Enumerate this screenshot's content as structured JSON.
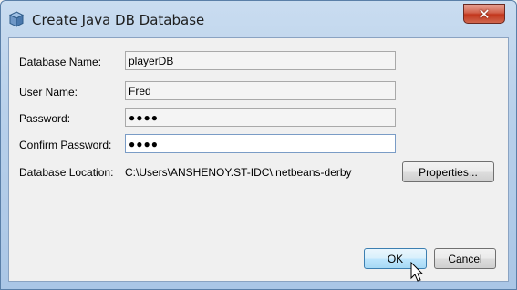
{
  "window": {
    "title": "Create Java DB Database",
    "title_icon": "database-icon",
    "close_label": "✕"
  },
  "form": {
    "database_name": {
      "label": "Database Name:",
      "value": "playerDB"
    },
    "user_name": {
      "label": "User Name:",
      "value": "Fred"
    },
    "password": {
      "label": "Password:",
      "value": "●●●●"
    },
    "confirm_password": {
      "label": "Confirm Password:",
      "value": "●●●●"
    },
    "database_location": {
      "label": "Database Location:",
      "value": "C:\\Users\\ANSHENOY.ST-IDC\\.netbeans-derby"
    }
  },
  "buttons": {
    "properties": "Properties...",
    "ok": "OK",
    "cancel": "Cancel"
  },
  "colors": {
    "title_bar": "#b8d0ea",
    "close_button": "#c2361c",
    "default_button": "#bee6fd"
  }
}
